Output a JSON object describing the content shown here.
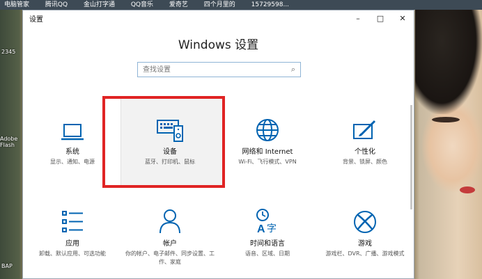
{
  "taskbar_top": [
    "电脑管家",
    "腾讯QQ",
    "金山打字通",
    "QQ音乐",
    "爱奇艺",
    "四个月里的",
    "15729598..."
  ],
  "desktop_icons": [
    "2345",
    "Adobe Flash",
    "BAP"
  ],
  "window": {
    "title": "设置",
    "controls": {
      "minimize": "–",
      "maximize": "□",
      "close": "✕"
    },
    "heading": "Windows 设置",
    "search": {
      "placeholder": "查找设置",
      "icon": "search-icon"
    }
  },
  "tiles": [
    {
      "id": "system",
      "name": "系统",
      "desc": "显示、通知、电源",
      "icon": "laptop-icon"
    },
    {
      "id": "devices",
      "name": "设备",
      "desc": "蓝牙、打印机、鼠标",
      "icon": "keyboard-speaker-icon"
    },
    {
      "id": "network",
      "name": "网络和 Internet",
      "desc": "Wi-Fi、飞行模式、VPN",
      "icon": "globe-icon"
    },
    {
      "id": "personalization",
      "name": "个性化",
      "desc": "背景、锁屏、颜色",
      "icon": "paintbrush-icon"
    },
    {
      "id": "apps",
      "name": "应用",
      "desc": "卸载、默认应用、可选功能",
      "icon": "apps-list-icon"
    },
    {
      "id": "accounts",
      "name": "帐户",
      "desc": "你的帐户、电子邮件、同步设置、工作、家庭",
      "icon": "person-icon"
    },
    {
      "id": "time_language",
      "name": "时间和语言",
      "desc": "语音、区域、日期",
      "icon": "time-language-icon"
    },
    {
      "id": "gaming",
      "name": "游戏",
      "desc": "游戏栏、DVR、广播、游戏模式",
      "icon": "xbox-icon"
    }
  ],
  "colors": {
    "accent": "#0063b1",
    "highlight": "#e02424"
  }
}
